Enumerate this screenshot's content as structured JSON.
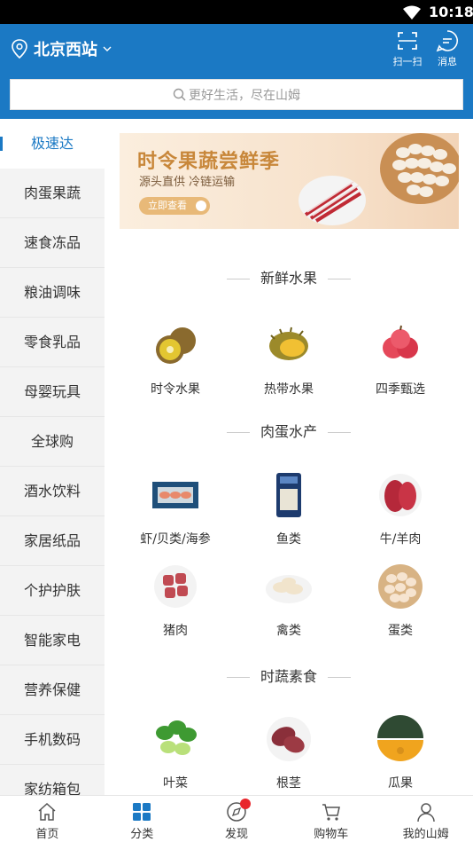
{
  "status_bar": {
    "time": "10:18"
  },
  "header": {
    "location": "北京西站",
    "scan_label": "扫一扫",
    "message_label": "消息",
    "search_placeholder": "更好生活，尽在山姆"
  },
  "sidebar": {
    "items": [
      {
        "label": "极速达",
        "active": true
      },
      {
        "label": "肉蛋果蔬"
      },
      {
        "label": "速食冻品"
      },
      {
        "label": "粮油调味"
      },
      {
        "label": "零食乳品"
      },
      {
        "label": "母婴玩具"
      },
      {
        "label": "全球购"
      },
      {
        "label": "酒水饮料"
      },
      {
        "label": "家居纸品"
      },
      {
        "label": "个护护肤"
      },
      {
        "label": "智能家电"
      },
      {
        "label": "营养保健"
      },
      {
        "label": "手机数码"
      },
      {
        "label": "家纺箱包"
      }
    ]
  },
  "banner": {
    "title": "时令果蔬尝鲜季",
    "subtitle": "源头直供 冷链运输",
    "button": "立即查看"
  },
  "sections": [
    {
      "title": "新鲜水果",
      "items": [
        {
          "label": "时令水果",
          "icon": "kiwi-icon"
        },
        {
          "label": "热带水果",
          "icon": "durian-icon"
        },
        {
          "label": "四季甄选",
          "icon": "apple-icon"
        }
      ]
    },
    {
      "title": "肉蛋水产",
      "items": [
        {
          "label": "虾/贝类/海参",
          "icon": "shrimp-icon"
        },
        {
          "label": "鱼类",
          "icon": "fish-pack-icon"
        },
        {
          "label": "牛/羊肉",
          "icon": "beef-icon"
        },
        {
          "label": "猪肉",
          "icon": "pork-icon"
        },
        {
          "label": "禽类",
          "icon": "poultry-icon"
        },
        {
          "label": "蛋类",
          "icon": "eggs-icon"
        }
      ]
    },
    {
      "title": "时蔬素食",
      "items": [
        {
          "label": "叶菜",
          "icon": "leafy-greens-icon"
        },
        {
          "label": "根茎",
          "icon": "sweet-potato-icon"
        },
        {
          "label": "瓜果",
          "icon": "pumpkin-icon"
        }
      ]
    }
  ],
  "tabbar": {
    "items": [
      {
        "label": "首页",
        "icon": "home-icon"
      },
      {
        "label": "分类",
        "icon": "grid-icon",
        "active": true
      },
      {
        "label": "发现",
        "icon": "compass-icon",
        "badge": true
      },
      {
        "label": "购物车",
        "icon": "cart-icon"
      },
      {
        "label": "我的山姆",
        "icon": "user-icon"
      }
    ]
  },
  "colors": {
    "brand": "#1b79c4",
    "badge": "#e8262c"
  }
}
